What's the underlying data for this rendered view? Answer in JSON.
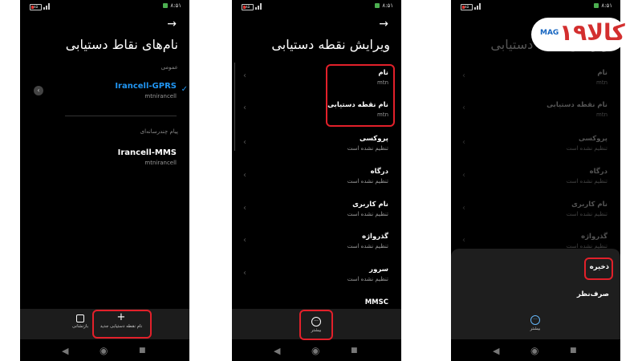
{
  "status_bar": {
    "battery": "۸۵",
    "time": "۸:۵۱"
  },
  "screen1": {
    "title": "نام‌های نقاط دستیابی",
    "section_general": "عمومی",
    "apn1_name": "Irancell-GPRS",
    "apn1_sub": "mtnirancell",
    "section_mms": "پیام چندرسانه‌ای",
    "apn2_name": "Irancell-MMS",
    "apn2_sub": "mtnirancell",
    "btn_reset": "بازنشانی",
    "btn_new_apn": "نام نقطه دستیابی جدید",
    "accent_color": "#2196f3"
  },
  "screen2": {
    "title": "ویرایش نقطه دستیابی",
    "rows": [
      {
        "title": "نام",
        "value": "mtn"
      },
      {
        "title": "نام نقطه دستیابی",
        "value": "mtn"
      },
      {
        "title": "پروکسی",
        "value": "تنظیم نشده است"
      },
      {
        "title": "درگاه",
        "value": "تنظیم نشده است"
      },
      {
        "title": "نام کاربری",
        "value": "تنظیم نشده است"
      },
      {
        "title": "گذرواژه",
        "value": "تنظیم نشده است"
      },
      {
        "title": "سرور",
        "value": "تنظیم نشده است"
      },
      {
        "title": "MMSC",
        "value": ""
      }
    ],
    "btn_more": "بیشتر"
  },
  "screen3": {
    "title": "ویرایش نقطه دستیابی",
    "rows": [
      {
        "title": "نام",
        "value": "mtn"
      },
      {
        "title": "نام نقطه دستیابی",
        "value": "mtn"
      },
      {
        "title": "پروکسی",
        "value": "تنظیم نشده است"
      },
      {
        "title": "درگاه",
        "value": "تنظیم نشده است"
      },
      {
        "title": "نام کاربری",
        "value": "تنظیم نشده است"
      },
      {
        "title": "گذرواژه",
        "value": "تنظیم نشده است"
      }
    ],
    "menu_save": "ذخیره",
    "menu_discard": "صرف‌نظر",
    "btn_more": "بیشتر"
  },
  "logo": {
    "mag": "MAG",
    "brand": "۱۹کالا"
  },
  "highlight_color": "#e2202a",
  "icons": [
    "back-arrow-icon",
    "check-icon",
    "collapse-icon",
    "plus-icon",
    "reset-icon",
    "more-icon",
    "chevron-left-icon",
    "nav-back-icon",
    "nav-home-icon",
    "nav-recent-icon"
  ]
}
